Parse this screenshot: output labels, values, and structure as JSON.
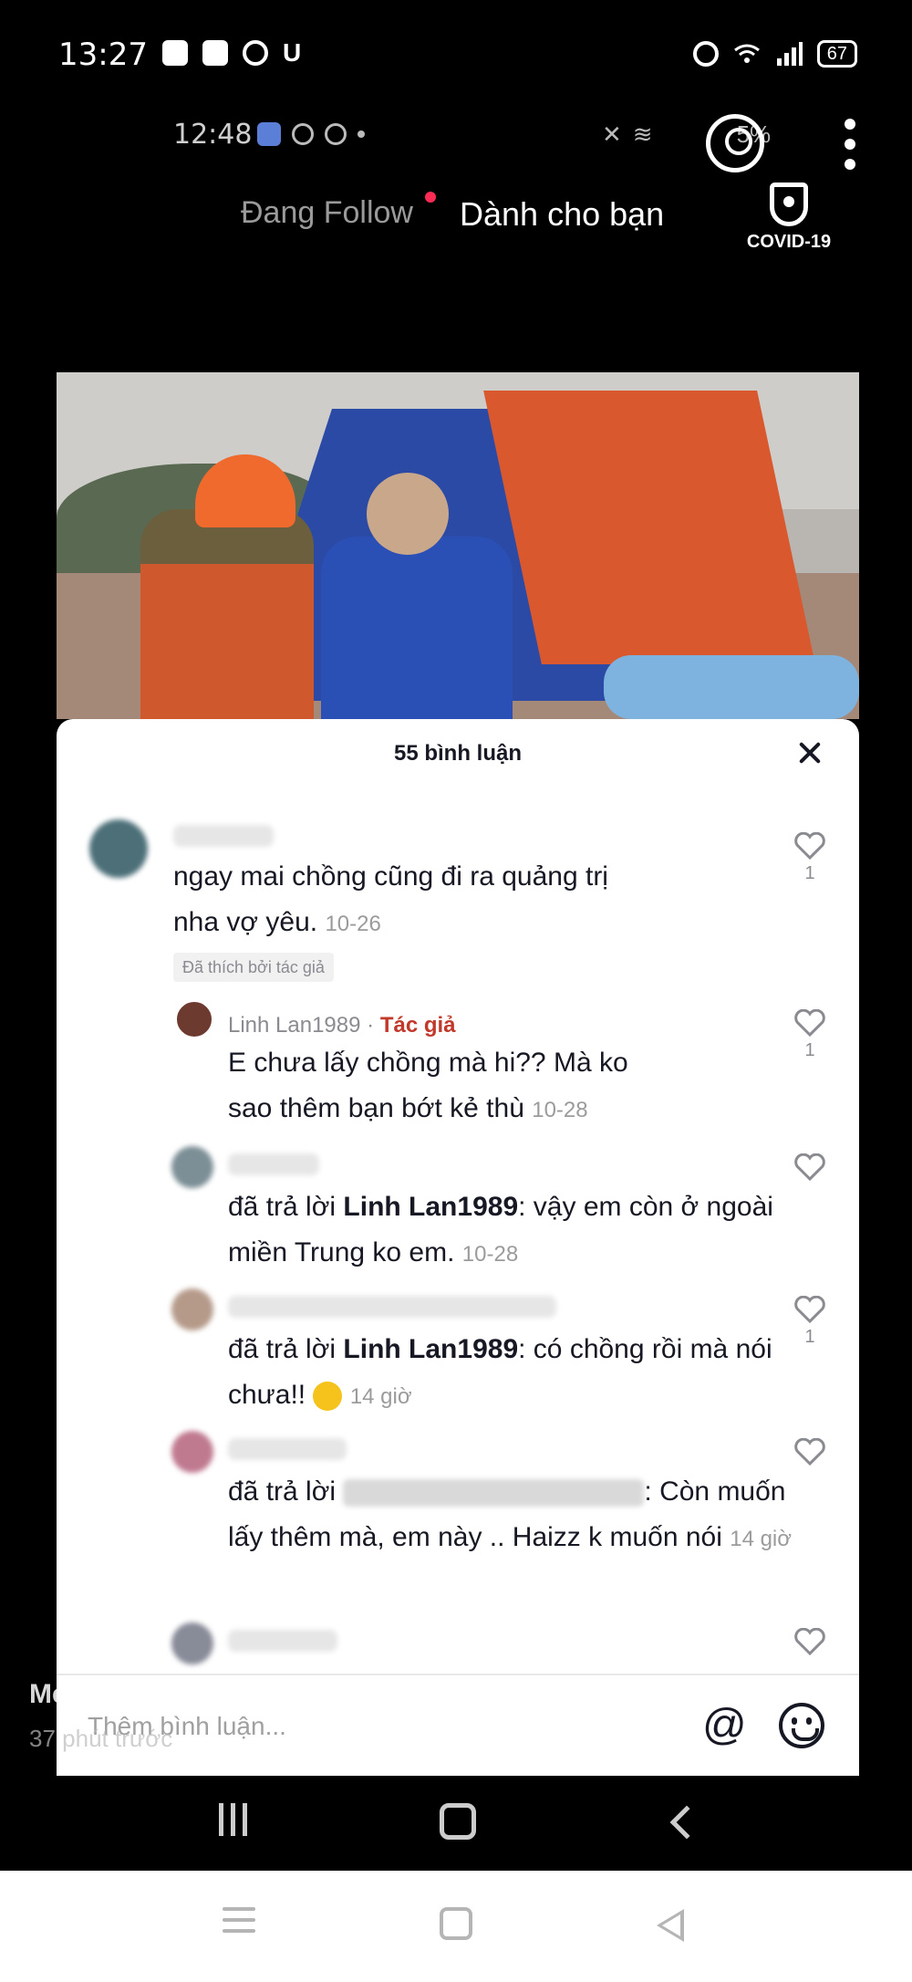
{
  "outer_status": {
    "time": "13:27",
    "battery": "67"
  },
  "inner_status": {
    "time": "12:48",
    "battery_text": "5%"
  },
  "top_nav": {
    "following_label": "Đang Follow",
    "for_you_label": "Dành cho bạn",
    "covid_label": "COVID-19"
  },
  "comments_sheet": {
    "title": "55 bình luận",
    "comments": [
      {
        "text": "ngay mai chồng cũng đi ra quảng trị nha vợ yêu.",
        "time": "10-26",
        "likes": "1",
        "liked_by_author": "Đã thích bởi tác giả"
      },
      {
        "username": "Linh Lan1989",
        "author_tag": "Tác giả",
        "text": "E chưa lấy chồng mà hi?? Mà ko sao thêm bạn bớt kẻ thù",
        "time": "10-28",
        "likes": "1"
      },
      {
        "reply_prefix": "đã trả lời",
        "reply_to": "Linh Lan1989",
        "text": ": vậy em còn ở ngoài miền Trung ko em.",
        "time": "10-28"
      },
      {
        "reply_prefix": "đã trả lời",
        "reply_to": "Linh Lan1989",
        "text": ": có chồng rồi mà nói chưa!!",
        "time": "14 giờ",
        "likes": "1"
      },
      {
        "reply_prefix": "đã trả lời",
        "text": ": Còn muốn lấy thêm mà, em này .. Haizz k muốn nói",
        "time": "14 giờ"
      }
    ],
    "input_placeholder": "Thêm bình luận...",
    "at_symbol": "@"
  },
  "ghost_overlay": {
    "user": "Mẹ Đạo",
    "time": "37 phút trước"
  },
  "icons": {
    "heart": "heart-icon",
    "close": "close-icon",
    "emoji": "emoji-icon",
    "covid": "shield-icon"
  },
  "colors": {
    "author_tag": "#c0392b",
    "like_gray": "#8a8b91",
    "accent_red": "#fe2c55"
  }
}
